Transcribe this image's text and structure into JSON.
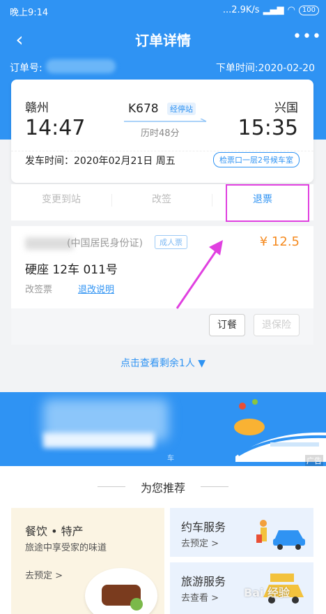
{
  "status_bar": {
    "time": "晚上9:14",
    "network_speed": "...2.9K/s",
    "battery": "100"
  },
  "nav": {
    "title": "订单详情",
    "back_icon": "back-arrow-icon",
    "more_icon": "more-dots-icon"
  },
  "order": {
    "order_no_label": "订单号:",
    "order_time": "下单时间:2020-02-20"
  },
  "ticket": {
    "from_station": "赣州",
    "to_station": "兴国",
    "from_time": "14:47",
    "to_time": "15:35",
    "train_no": "K678",
    "via_label": "经停站",
    "duration": "历时48分",
    "depart_time": "发车时间：2020年02月21日 周五",
    "gate": "检票口一层2号候车室"
  },
  "actions": {
    "change_station": "变更到站",
    "rebook": "改签",
    "refund": "退票"
  },
  "passenger": {
    "id_type": "(中国居民身份证)",
    "ticket_type": "成人票",
    "price": "¥ 12.5",
    "seat": "硬座 12车 011号",
    "change_tag": "改签票",
    "refund_policy": "退改说明",
    "meal_button": "订餐",
    "insurance_button": "退保险"
  },
  "view_more": "点击查看剩余1人 ▼",
  "banner": {
    "partial_text": "车",
    "ad_label": "广告"
  },
  "recommend": {
    "title": "为您推荐",
    "food": {
      "title": "餐饮 • 特产",
      "subtitle": "旅途中享受家的味道",
      "link": "去预定 >"
    },
    "car": {
      "title": "约车服务",
      "link": "去预定 >"
    },
    "tour": {
      "title": "旅游服务",
      "link": "去查看 >"
    }
  },
  "watermark": "Bai 经验",
  "colors": {
    "primary": "#2f93f3",
    "price": "#f58a1f",
    "highlight": "#e040e0"
  }
}
